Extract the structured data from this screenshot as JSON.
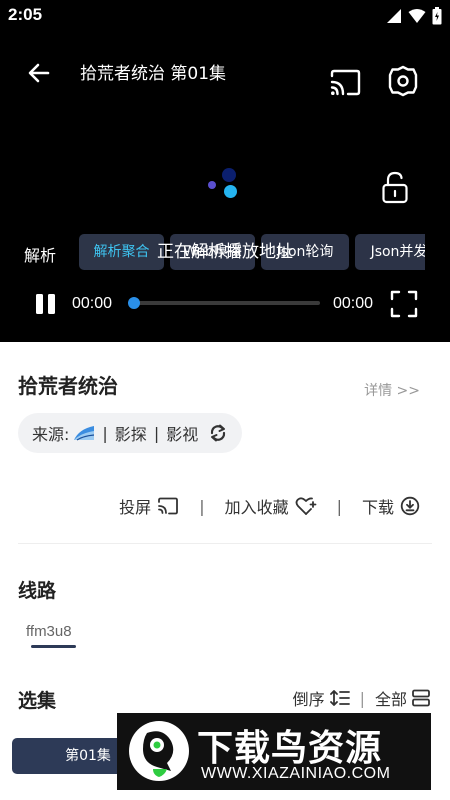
{
  "status_bar": {
    "time": "2:05"
  },
  "player": {
    "title": "拾荒者统治 第01集",
    "parse_label": "解析",
    "parse_options": [
      "解析聚合",
      "Web嗅探",
      "Json轮询",
      "Json并发"
    ],
    "active_parse_option": "解析聚合",
    "loading_text": "正在解析播放地址",
    "current_time": "00:00",
    "total_time": "00:00",
    "progress": 0
  },
  "show": {
    "title": "拾荒者统治",
    "details_link": "详情 >>",
    "source_label": "来源:",
    "source_parts": [
      "影探",
      "影视"
    ]
  },
  "actions": {
    "cast": "投屏",
    "favorite": "加入收藏",
    "download": "下载"
  },
  "routes": {
    "title": "线路",
    "items": [
      "ffm3u8"
    ]
  },
  "episodes": {
    "title": "选集",
    "order": "倒序",
    "all": "全部",
    "items": [
      "第01集"
    ]
  },
  "watermark": {
    "name": "下载鸟资源",
    "url": "WWW.XIAZAINIAO.COM"
  },
  "colors": {
    "accent": "#3ec3f0",
    "chip_bg": "#2c3347",
    "episode_chip": "#2d3a57",
    "progress_knob": "#2a8fe8"
  }
}
